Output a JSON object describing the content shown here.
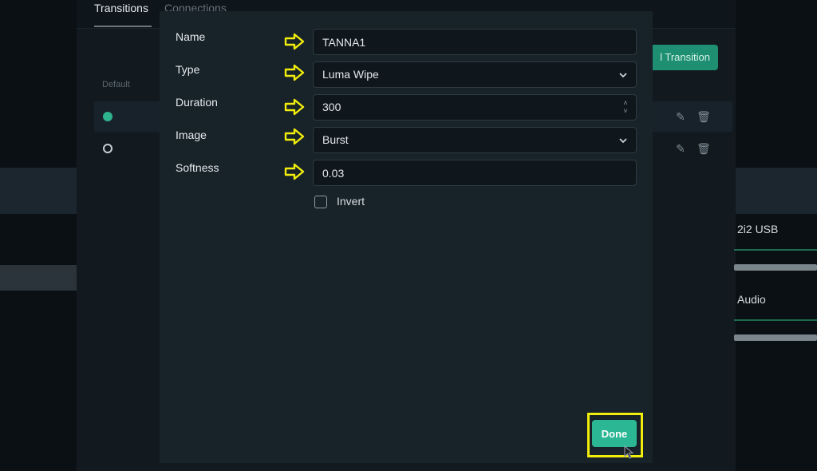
{
  "background": {
    "tabs": [
      "Transitions",
      "Connections"
    ],
    "default_label": "Default",
    "add_button_label": "l Transition",
    "right_labels": [
      "2i2 USB",
      "Audio"
    ]
  },
  "modal": {
    "fields": {
      "name": {
        "label": "Name",
        "value": "TANNA1"
      },
      "type": {
        "label": "Type",
        "value": "Luma Wipe"
      },
      "duration": {
        "label": "Duration",
        "value": "300"
      },
      "image": {
        "label": "Image",
        "value": "Burst"
      },
      "softness": {
        "label": "Softness",
        "value": "0.03"
      }
    },
    "invert_label": "Invert",
    "invert_checked": false,
    "done_label": "Done"
  },
  "colors": {
    "accent": "#2bb794",
    "highlight": "#f2ee0c"
  }
}
